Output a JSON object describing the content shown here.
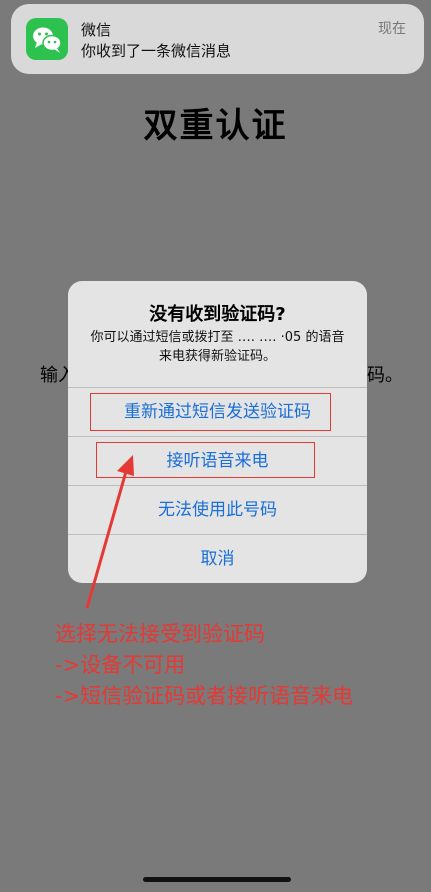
{
  "notification": {
    "app_name": "微信",
    "message": "你收到了一条微信消息",
    "time": "现在",
    "icon": "wechat-icon",
    "icon_color": "#2dc150"
  },
  "page": {
    "title": "双重认证",
    "bg_left_text": "输入",
    "bg_right_text": "码。"
  },
  "alert": {
    "title": "没有收到验证码?",
    "message": "你可以通过短信或拨打至 ‥‥ ‥‥ ·05 的语音来电获得新验证码。",
    "buttons": [
      {
        "label": "重新通过短信发送验证码"
      },
      {
        "label": "接听语音来电"
      },
      {
        "label": "无法使用此号码"
      },
      {
        "label": "取消"
      }
    ],
    "button_color": "#1a6fd8"
  },
  "annotation": {
    "lines": [
      "选择无法接受到验证码",
      "->设备不可用",
      "->短信验证码或者接听语音来电"
    ],
    "color": "#e53935"
  }
}
